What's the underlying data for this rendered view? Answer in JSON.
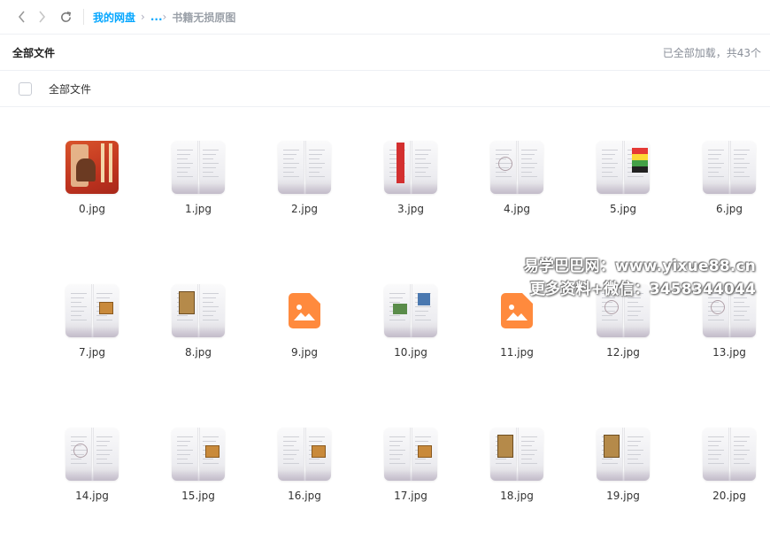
{
  "nav": {
    "back_icon": "chevron-left-icon",
    "forward_icon": "chevron-right-icon",
    "refresh_icon": "refresh-icon"
  },
  "breadcrumb": {
    "root": "我的网盘",
    "ellipsis": "...",
    "current": "书籍无损原图"
  },
  "header": {
    "title": "全部文件",
    "status": "已全部加载，共43个"
  },
  "selectbar": {
    "label": "全部文件"
  },
  "files": [
    {
      "name": "0.jpg",
      "thumb": "cover"
    },
    {
      "name": "1.jpg",
      "thumb": "book"
    },
    {
      "name": "2.jpg",
      "thumb": "book"
    },
    {
      "name": "3.jpg",
      "thumb": "book-red"
    },
    {
      "name": "4.jpg",
      "thumb": "book-diagram"
    },
    {
      "name": "5.jpg",
      "thumb": "book-flag"
    },
    {
      "name": "6.jpg",
      "thumb": "book"
    },
    {
      "name": "7.jpg",
      "thumb": "book-pic-right"
    },
    {
      "name": "8.jpg",
      "thumb": "book-pic-left"
    },
    {
      "name": "9.jpg",
      "thumb": "image-placeholder"
    },
    {
      "name": "10.jpg",
      "thumb": "book-pic-both"
    },
    {
      "name": "11.jpg",
      "thumb": "image-placeholder"
    },
    {
      "name": "12.jpg",
      "thumb": "book-diagram"
    },
    {
      "name": "13.jpg",
      "thumb": "book-diagram"
    },
    {
      "name": "14.jpg",
      "thumb": "book-diagram"
    },
    {
      "name": "15.jpg",
      "thumb": "book-pic-right"
    },
    {
      "name": "16.jpg",
      "thumb": "book-pic-right"
    },
    {
      "name": "17.jpg",
      "thumb": "book-pic-right"
    },
    {
      "name": "18.jpg",
      "thumb": "book-pic-left"
    },
    {
      "name": "19.jpg",
      "thumb": "book-pic-left"
    },
    {
      "name": "20.jpg",
      "thumb": "book"
    }
  ],
  "watermark": {
    "line1": "易学巴巴网：www.yixue88.cn",
    "line2": "更多资料+微信：3458344044"
  },
  "colors": {
    "accent": "#06a7ff",
    "image_icon": "#ff8a3d"
  }
}
